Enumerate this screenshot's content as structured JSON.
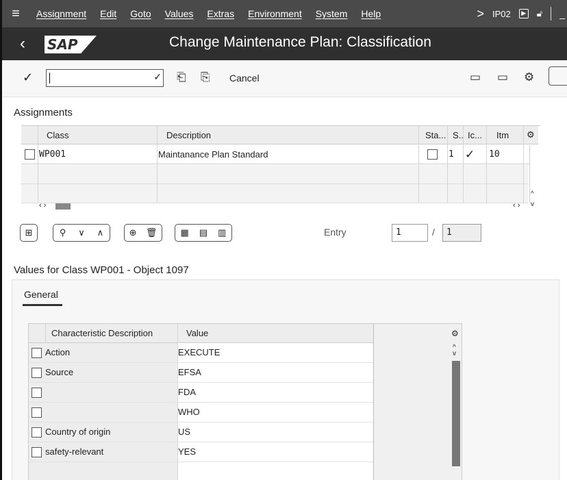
{
  "menu": {
    "items": [
      "Assignment",
      "Edit",
      "Goto",
      "Values",
      "Extras",
      "Environment",
      "System",
      "Help"
    ],
    "transaction": "IP02"
  },
  "title": {
    "logo": "SAP",
    "text": "Change Maintenance Plan: Classification"
  },
  "toolbar": {
    "cancel": "Cancel"
  },
  "assignments": {
    "section_title": "Assignments",
    "headers": {
      "class": "Class",
      "description": "Description",
      "status": "Sta...",
      "s": "S..",
      "icon": "Ic...",
      "item": "Itm"
    },
    "rows": [
      {
        "class": "WP001",
        "description": "Maintanance Plan Standard",
        "s": "1",
        "icon": "✓",
        "item": "10"
      }
    ]
  },
  "entry": {
    "label": "Entry",
    "current": "1",
    "total": "1"
  },
  "values": {
    "section_title": "Values for Class WP001 - Object 1097",
    "tab": "General",
    "headers": {
      "desc": "Characteristic Description",
      "value": "Value"
    },
    "rows": [
      {
        "desc": "Action",
        "value": "EXECUTE"
      },
      {
        "desc": "Source",
        "value": "EFSA"
      },
      {
        "desc": "",
        "value": "FDA"
      },
      {
        "desc": "",
        "value": "WHO"
      },
      {
        "desc": "Country of origin",
        "value": "US"
      },
      {
        "desc": "safety-relevant",
        "value": "YES"
      }
    ]
  }
}
